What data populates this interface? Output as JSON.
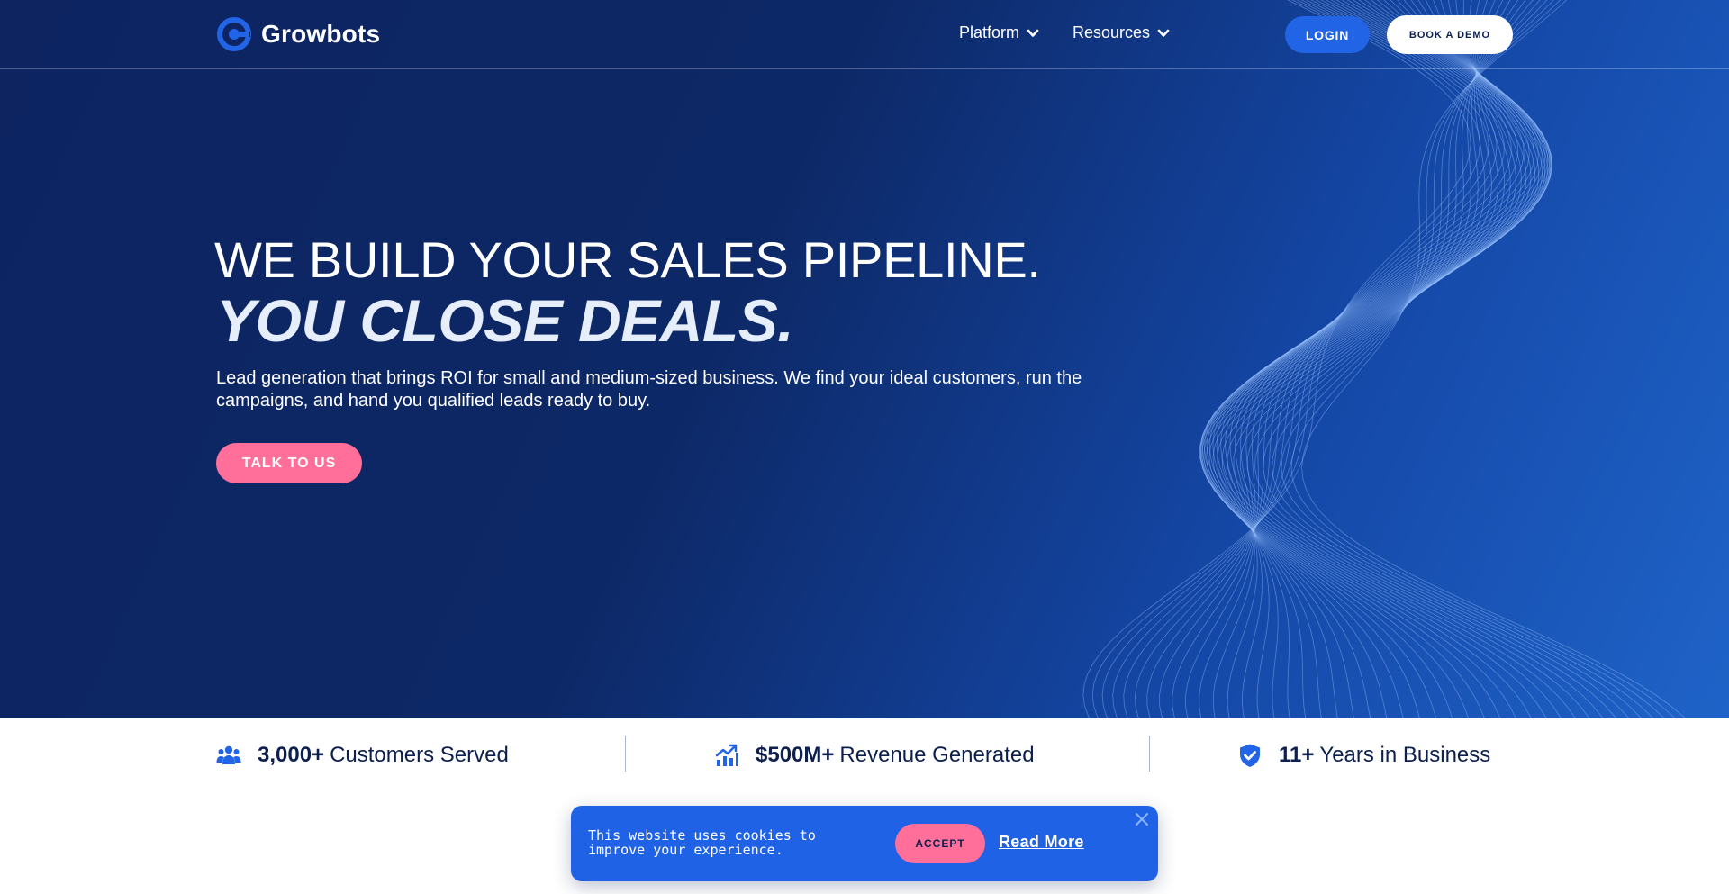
{
  "brand": {
    "name": "Growbots",
    "accent": "#2264e6",
    "pink": "#ff6f9a",
    "navy": "#0d1f4d"
  },
  "nav": {
    "items": [
      {
        "label": "Platform",
        "icon": "chevron-down-icon"
      },
      {
        "label": "Resources",
        "icon": "chevron-down-icon"
      }
    ],
    "login_label": "LOGIN",
    "demo_label": "BOOK A DEMO"
  },
  "hero": {
    "headline_line1": "WE BUILD YOUR SALES PIPELINE.",
    "headline_line2": "YOU CLOSE DEALS.",
    "subtext": "Lead generation that brings ROI for small and medium-sized business. We find your ideal customers, run the campaigns, and hand you qualified leads ready to buy.",
    "cta_label": "TALK TO US"
  },
  "stats": [
    {
      "icon": "users-icon",
      "value": "3,000+",
      "label": "Customers Served"
    },
    {
      "icon": "growth-chart-icon",
      "value": "$500M+",
      "label": "Revenue Generated"
    },
    {
      "icon": "shield-check-icon",
      "value": "11+",
      "label": "Years in Business"
    }
  ],
  "cookie": {
    "message": "This website uses cookies to improve your experience.",
    "accept_label": "ACCEPT",
    "read_more_label": "Read More"
  }
}
